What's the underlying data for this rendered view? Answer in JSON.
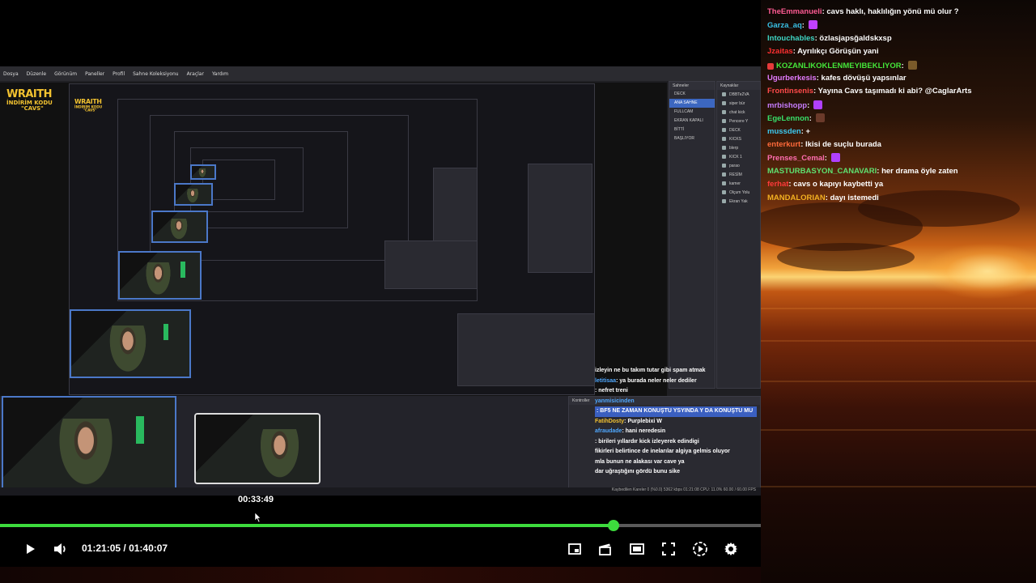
{
  "player": {
    "hover_timestamp": "00:33:49",
    "current_time": "01:21:05",
    "duration": "01:40:07",
    "time_separator": " / ",
    "progress_fraction": 0.806,
    "accent_color": "#3ddb3d",
    "icons": [
      "play-icon",
      "volume-icon",
      "miniplayer-icon",
      "theater-icon",
      "captions-icon",
      "fullscreen-icon",
      "speed-icon",
      "settings-icon"
    ]
  },
  "obs": {
    "sponsor": {
      "line1": "WRAITH",
      "line2": "İNDİRİM KODU",
      "line3": "\"CAVS\""
    },
    "scenes_title": "Sahneler",
    "sources_title": "Kaynaklar",
    "controls_title": "Kontroller",
    "scenes": [
      "DECK",
      "ANA SAHNE",
      "FULLCAM",
      "EKRAN KAPALI",
      "BİTTİ",
      "BAŞLIYOR"
    ],
    "sources": [
      "DBBTe2VA",
      "siper bür",
      "chat kick",
      "Pencere Y",
      "DECK",
      "KICKS",
      "blerp",
      "KICK 1",
      "parao",
      "RESİM",
      "kamer",
      "Olçum Yolu",
      "Ekran Yak"
    ],
    "mini_chat": [
      {
        "name": "",
        "text": "izleyin ne bu takım tutar gibi spam atmak"
      },
      {
        "name": "letitisaa",
        "text": ": ya burada neler neler dediler"
      },
      {
        "name": "",
        "text": ": nefret treni"
      },
      {
        "name": "yanmisicinden",
        "text": ""
      },
      {
        "name": "",
        "text": ": BF5 NE ZAMAN KONUŞTU YSYINDA Y DA KONUŞTU MU"
      },
      {
        "name": "FatihDosty",
        "text": ": Purplebixi W"
      },
      {
        "name": "afraudade",
        "text": ": hani neredesin"
      },
      {
        "name": "",
        "text": ": birileri yıllardır kick izleyerek edindigi"
      },
      {
        "name": "",
        "text": "fikirleri belirtince de inelarılar algiya gelmis oluyor"
      },
      {
        "name": "",
        "text": "mla bunun ne alakası var cave ya"
      },
      {
        "name": "",
        "text": "dar uğraştığını gördü bunu sike"
      }
    ],
    "status_text": "Kaybedilen Kareler 0 (%0.0)   5362 kbps   01:21:08   CPU: 11.0%  60.00 / 60.00 FPS"
  },
  "chat": {
    "messages": [
      {
        "name": "TheEmmanueli",
        "color": "#ff5b93",
        "text": ": cavs haklı, haklılığın yönü mü olur ?"
      },
      {
        "name": "Garza_aq",
        "color": "#39c0e6",
        "text": ":",
        "emote": "#c040ff"
      },
      {
        "name": "Intouchables",
        "color": "#3fd6c5",
        "text": ": özlasjapsğaldskxsp"
      },
      {
        "name": "Jzaitas",
        "color": "#ff3030",
        "text": ": Ayrılıkçı Görüşün yani"
      },
      {
        "name": "KOZANLIKOKLENMEYIBEKLIYOR",
        "color": "#44e63a",
        "text": ":",
        "emote": "#7a5a2a",
        "badge": "#e63a3a"
      },
      {
        "name": "Ugurberkesis",
        "color": "#e37bff",
        "text": ": kafes dövüşü yapsınlar"
      },
      {
        "name": "Frontinsenis",
        "color": "#ff4a4a",
        "text": ": Yayına Cavs taşımadı ki abi? @CaglarArts"
      },
      {
        "name": "mrbishopp",
        "color": "#c77dff",
        "text": ":",
        "emote": "#b040ff"
      },
      {
        "name": "EgeLennon",
        "color": "#38e06a",
        "text": ":",
        "emote": "#6b3a2a"
      },
      {
        "name": "mussden",
        "color": "#3dc9f0",
        "text": ": +"
      },
      {
        "name": "enterkurt",
        "color": "#ff6a3a",
        "text": ": Ikisi de suçlu burada"
      },
      {
        "name": "Prenses_Cemal",
        "color": "#ff6db0",
        "text": ":",
        "emote": "#b040ff"
      },
      {
        "name": "MASTURBASYON_CANAVARI",
        "color": "#5fe070",
        "text": ": her drama öyle zaten"
      },
      {
        "name": "ferhat",
        "color": "#ff3a3a",
        "text": ": cavs o kapıyı kaybetti ya"
      },
      {
        "name": "MANDALORIAN",
        "color": "#f2b021",
        "text": ": dayı istemedi"
      }
    ]
  }
}
